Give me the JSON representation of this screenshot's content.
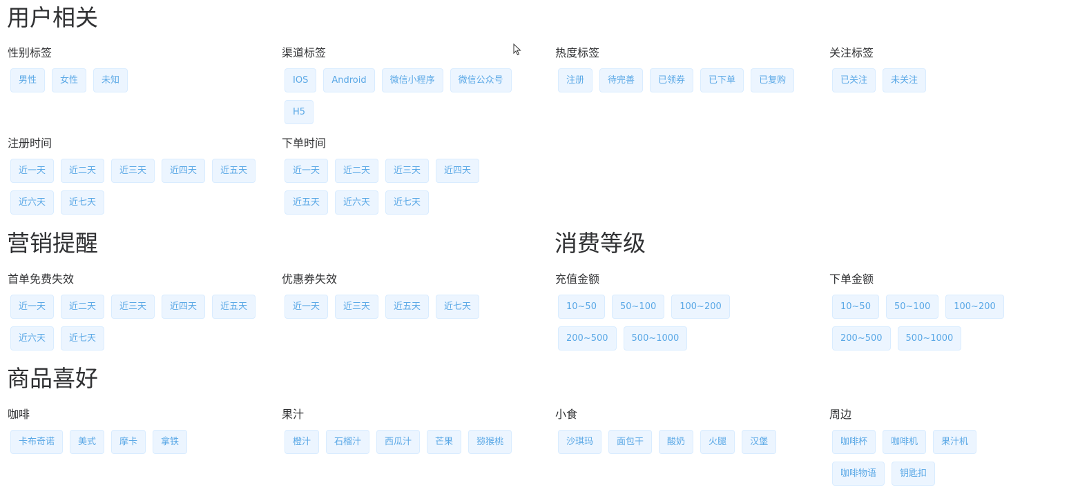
{
  "sections": {
    "user": {
      "title": "用户相关",
      "groups": [
        {
          "title": "性别标签",
          "tags": [
            "男性",
            "女性",
            "未知"
          ]
        },
        {
          "title": "渠道标签",
          "tags": [
            "IOS",
            "Android",
            "微信小程序",
            "微信公众号",
            "H5"
          ]
        },
        {
          "title": "热度标签",
          "tags": [
            "注册",
            "待完善",
            "已领券",
            "已下单",
            "已复购"
          ]
        },
        {
          "title": "关注标签",
          "tags": [
            "已关注",
            "未关注"
          ]
        },
        {
          "title": "注册时间",
          "tags": [
            "近一天",
            "近二天",
            "近三天",
            "近四天",
            "近五天",
            "近六天",
            "近七天"
          ]
        },
        {
          "title": "下单时间",
          "tags": [
            "近一天",
            "近二天",
            "近三天",
            "近四天",
            "近五天",
            "近六天",
            "近七天"
          ]
        }
      ]
    },
    "marketing": {
      "title": "营销提醒",
      "groups": [
        {
          "title": "首单免费失效",
          "tags": [
            "近一天",
            "近二天",
            "近三天",
            "近四天",
            "近五天",
            "近六天",
            "近七天"
          ]
        },
        {
          "title": "优惠券失效",
          "tags": [
            "近一天",
            "近三天",
            "近五天",
            "近七天"
          ]
        }
      ]
    },
    "consumption": {
      "title": "消费等级",
      "groups": [
        {
          "title": "充值金额",
          "tags": [
            "10~50",
            "50~100",
            "100~200",
            "200~500",
            "500~1000"
          ]
        },
        {
          "title": "下单金额",
          "tags": [
            "10~50",
            "50~100",
            "100~200",
            "200~500",
            "500~1000"
          ]
        }
      ]
    },
    "preference": {
      "title": "商品喜好",
      "groups": [
        {
          "title": "咖啡",
          "tags": [
            "卡布奇诺",
            "美式",
            "摩卡",
            "拿铁"
          ]
        },
        {
          "title": "果汁",
          "tags": [
            "橙汁",
            "石榴汁",
            "西瓜汁",
            "芒果",
            "猕猴桃"
          ]
        },
        {
          "title": "小食",
          "tags": [
            "沙琪玛",
            "面包干",
            "酸奶",
            "火腿",
            "汉堡"
          ]
        },
        {
          "title": "周边",
          "tags": [
            "咖啡杯",
            "咖啡机",
            "果汁机",
            "咖啡物语",
            "钥匙扣"
          ]
        }
      ]
    }
  }
}
